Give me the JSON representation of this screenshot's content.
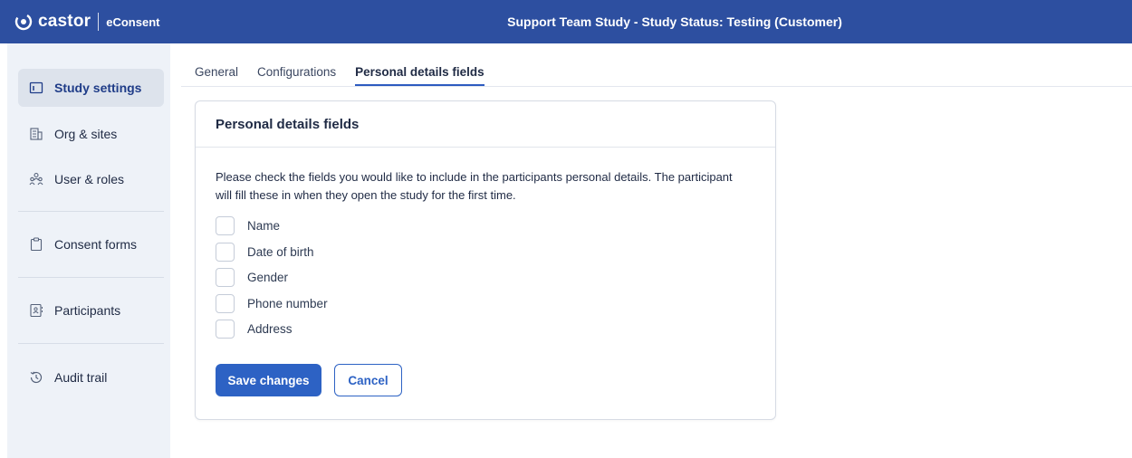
{
  "brand": {
    "logo_text": "castor",
    "product": "eConsent"
  },
  "header": {
    "study_title": "Support Team Study  - Study Status: Testing (Customer)"
  },
  "sidebar": {
    "items": [
      {
        "label": "Study settings",
        "icon": "settings-window-icon",
        "active": true
      },
      {
        "label": "Org & sites",
        "icon": "building-icon"
      },
      {
        "label": "User & roles",
        "icon": "users-icon"
      },
      {
        "label": "Consent forms",
        "icon": "clipboard-icon"
      },
      {
        "label": "Participants",
        "icon": "contact-book-icon"
      },
      {
        "label": "Audit trail",
        "icon": "history-icon"
      }
    ]
  },
  "tabs": [
    {
      "label": "General"
    },
    {
      "label": "Configurations"
    },
    {
      "label": "Personal details fields",
      "active": true
    }
  ],
  "card": {
    "title": "Personal details fields",
    "description": "Please check the fields you would like to include in the participants personal details. The participant will fill these in when they open the study for the first time.",
    "fields": [
      {
        "label": "Name",
        "checked": false
      },
      {
        "label": "Date of birth",
        "checked": false
      },
      {
        "label": "Gender",
        "checked": false
      },
      {
        "label": "Phone number",
        "checked": false
      },
      {
        "label": "Address",
        "checked": false
      }
    ],
    "save_label": "Save changes",
    "cancel_label": "Cancel"
  },
  "colors": {
    "topbar": "#2d4fa0",
    "primary": "#2d62c4",
    "sidebar_bg": "#eef2f8"
  }
}
